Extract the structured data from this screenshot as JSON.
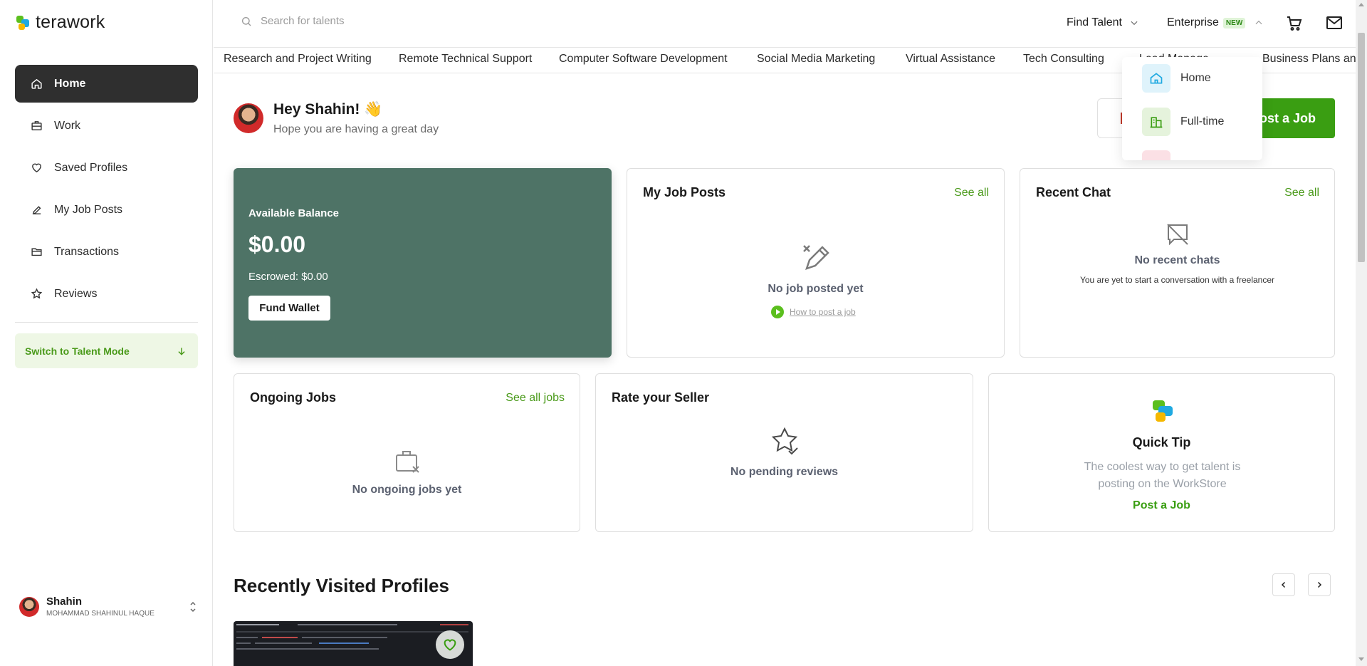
{
  "brand": {
    "name": "terawork",
    "accent": "#3a9e12",
    "dark": "#2f2f2f",
    "wallet_bg": "#4e7366"
  },
  "sidebar": {
    "items": [
      {
        "label": "Home",
        "icon": "home-icon",
        "active": true
      },
      {
        "label": "Work",
        "icon": "briefcase-icon",
        "active": false
      },
      {
        "label": "Saved Profiles",
        "icon": "heart-icon",
        "active": false
      },
      {
        "label": "My Job Posts",
        "icon": "pen-icon",
        "active": false
      },
      {
        "label": "Transactions",
        "icon": "folder-icon",
        "active": false
      },
      {
        "label": "Reviews",
        "icon": "star-icon",
        "active": false
      }
    ],
    "switch_mode": "Switch to Talent Mode",
    "profile": {
      "name": "Shahin",
      "full_name": "MOHAMMAD SHAHINUL HAQUE"
    }
  },
  "header": {
    "search_placeholder": "Search for talents",
    "find_talent": "Find Talent",
    "enterprise": "Enterprise",
    "new_badge": "NEW"
  },
  "categories": [
    "Research and Project Writing",
    "Remote Technical Support",
    "Computer Software Development",
    "Social Media Marketing",
    "Virtual Assistance",
    "Tech Consulting",
    "Lead Manage",
    "Business Plans and"
  ],
  "dropdown": {
    "items": [
      "Home",
      "Full-time"
    ]
  },
  "greeting": {
    "title": "Hey Shahin! 👋",
    "subtitle": "Hope you are having a great day",
    "post_job": "ost a Job"
  },
  "wallet": {
    "label": "Available Balance",
    "balance": "$0.00",
    "escrowed": "Escrowed: $0.00",
    "fund_button": "Fund Wallet"
  },
  "job_posts": {
    "title": "My Job Posts",
    "see_all": "See all",
    "empty": "No job posted yet",
    "how_to": "How to post a job"
  },
  "recent_chat": {
    "title": "Recent Chat",
    "see_all": "See all",
    "empty": "No recent chats",
    "empty_sub": "You are yet to start a conversation with a freelancer"
  },
  "ongoing_jobs": {
    "title": "Ongoing Jobs",
    "see_all": "See all jobs",
    "empty": "No ongoing jobs yet"
  },
  "rate_seller": {
    "title": "Rate your Seller",
    "empty": "No pending reviews"
  },
  "quick_tip": {
    "title": "Quick Tip",
    "body": "The coolest way to get talent is posting on the WorkStore",
    "link": "Post a Job"
  },
  "recent_profiles": {
    "title": "Recently Visited Profiles"
  }
}
